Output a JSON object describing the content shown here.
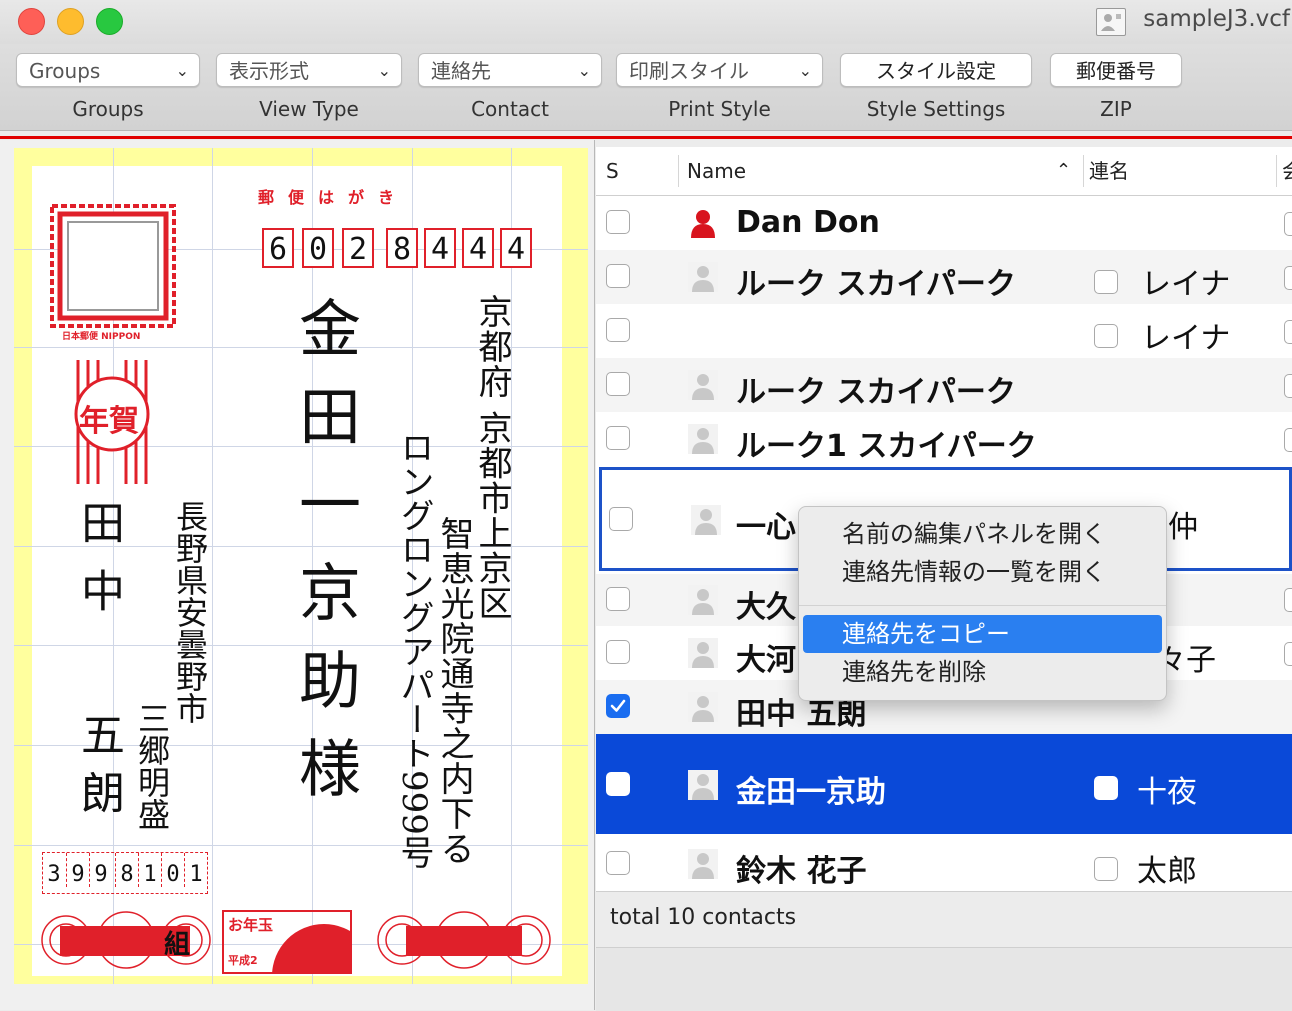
{
  "window": {
    "title": "sampleJ3.vcf"
  },
  "colors": {
    "accent": "#0a49d8",
    "postal_red": "#e0202a",
    "card_bg": "#ffff9e"
  },
  "toolbar": {
    "groups": {
      "value": "Groups",
      "label": "Groups"
    },
    "view_type": {
      "value": "表示形式",
      "label": "View Type"
    },
    "contact": {
      "value": "連絡先",
      "label": "Contact"
    },
    "print_style": {
      "value": "印刷スタイル",
      "label": "Print Style"
    },
    "style_settings": {
      "button": "スタイル設定",
      "label": "Style Settings"
    },
    "zip": {
      "button": "郵便番号",
      "label": "ZIP"
    }
  },
  "postcard": {
    "header": "郵便はがき",
    "zip_digits": [
      "6",
      "0",
      "2",
      "8",
      "4",
      "4",
      "4"
    ],
    "stamp_caption": "日本郵便 NIPPON",
    "new_year": "年賀",
    "recipient_name": "金田一京助様",
    "recipient_addr1": "京都府 京都市上京区",
    "recipient_addr2": "智恵光院通寺之内下る",
    "recipient_addr3": "ロングロングアパート999号",
    "sender_surname": "田中",
    "sender_given": "五朗",
    "sender_addr1": "長野県安曇野市",
    "sender_addr2": "三郷明盛",
    "sender_zip": [
      "3",
      "9",
      "9",
      "8",
      "1",
      "0",
      "1"
    ],
    "lottery_label": "お年玉",
    "lottery_sub": "平成2",
    "class_mark": "組"
  },
  "list": {
    "headers": {
      "s": "S",
      "name": "Name",
      "renmei": "連名",
      "more": "会"
    },
    "rows": [
      {
        "name": "Dan Don",
        "renmei": "",
        "checked": false
      },
      {
        "name": "ルーク スカイパーク",
        "renmei": "レイナ",
        "checked": false
      },
      {
        "name": "",
        "renmei": "レイナ",
        "checked": false
      },
      {
        "name": "ルーク スカイパーク",
        "renmei": "",
        "checked": false
      },
      {
        "name": "ルーク1 スカイパーク",
        "renmei": "",
        "checked": false
      },
      {
        "name": "一心",
        "renmei": "仲",
        "checked": false
      },
      {
        "name": "大久",
        "renmei": "",
        "checked": false
      },
      {
        "name": "大河",
        "renmei": "々子",
        "checked": false
      },
      {
        "name": "田中 五朗",
        "renmei": "",
        "checked": true
      },
      {
        "name": "金田一京助",
        "renmei": "十夜",
        "checked": false
      },
      {
        "name": "鈴木 花子",
        "renmei": "太郎",
        "checked": false
      }
    ],
    "footer": "total 10 contacts"
  },
  "context_menu": {
    "items": [
      "名前の編集パネルを開く",
      "連絡先情報の一覧を開く",
      "連絡先をコピー",
      "連絡先を削除"
    ],
    "highlighted": "連絡先をコピー"
  }
}
